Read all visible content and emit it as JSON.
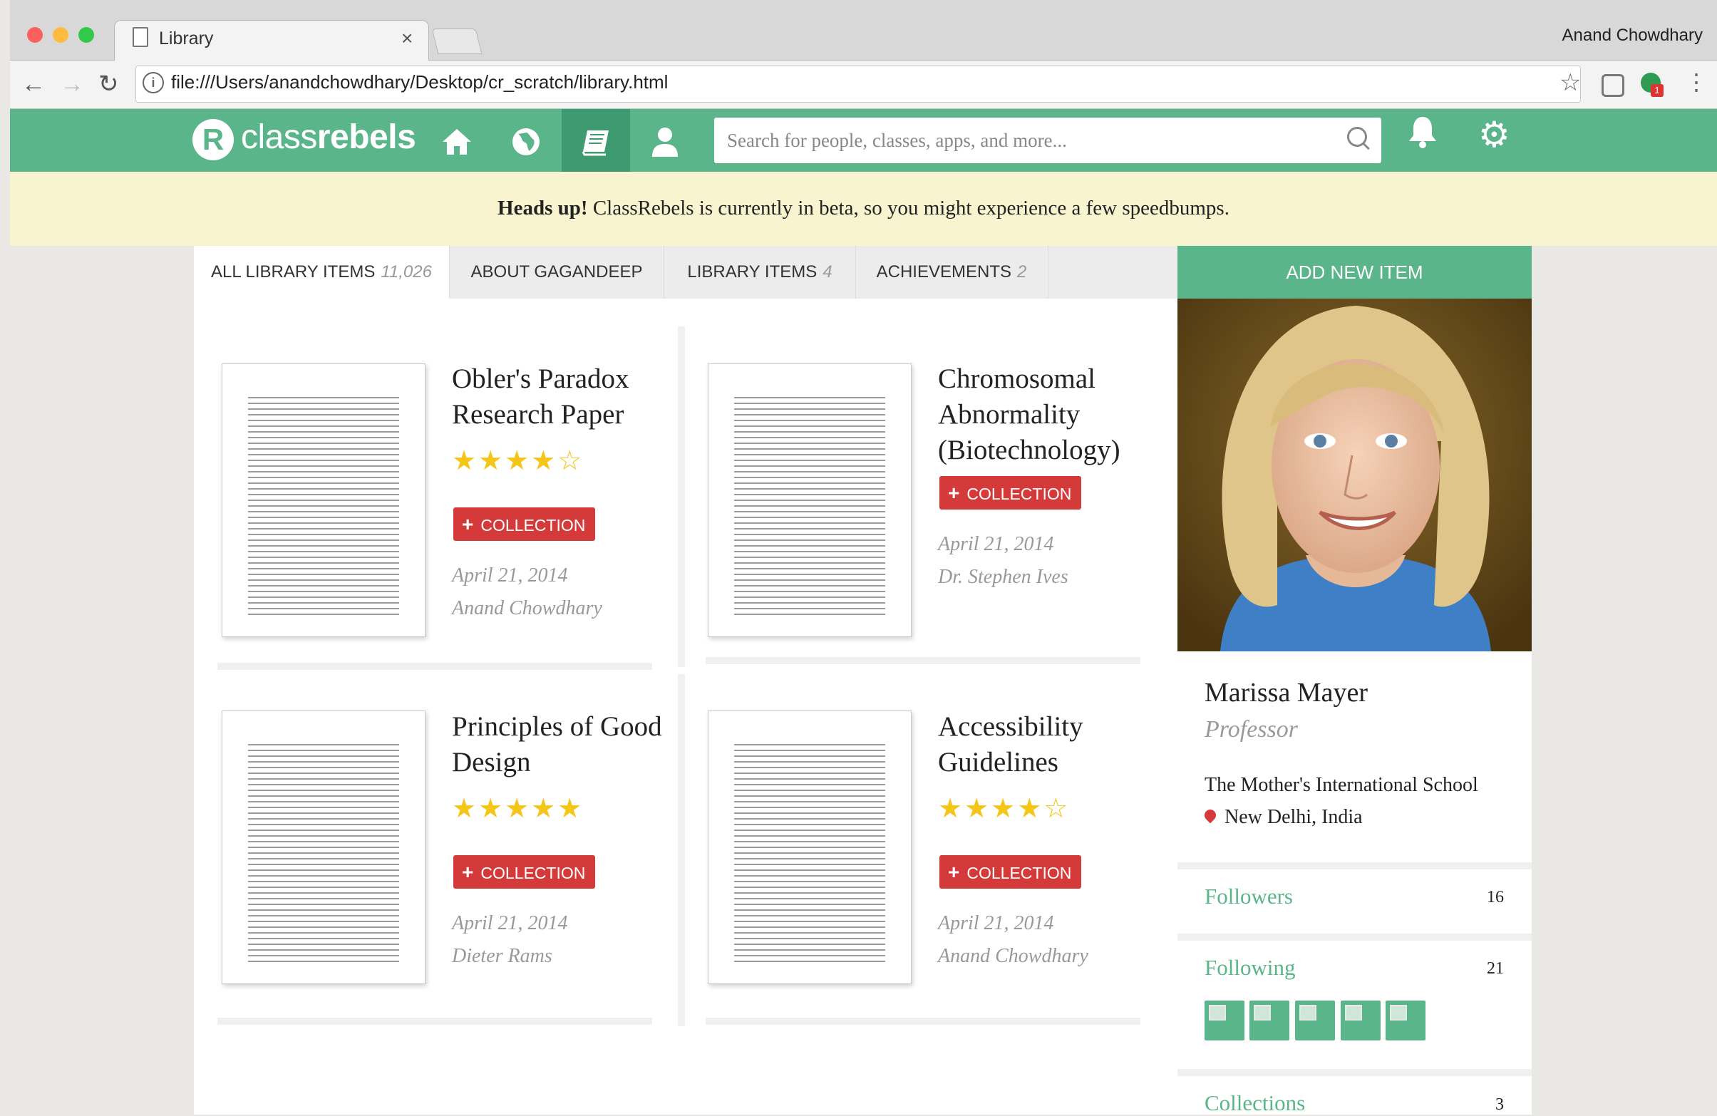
{
  "browser": {
    "tab_title": "Library",
    "tab_close": "×",
    "user_name": "Anand Chowdhary",
    "url": "file:///Users/anandchowdhary/Desktop/cr_scratch/library.html",
    "back": "←",
    "forward": "→",
    "reload": "↻",
    "info": "i",
    "bookmark": "☆",
    "menu": "⋮",
    "extension_badge": "1"
  },
  "app": {
    "logo_letter": "R",
    "logo_light": "class",
    "logo_bold": "rebels",
    "search_placeholder": "Search for people, classes, apps, and more...",
    "nav_icons": {
      "home": "home-icon",
      "globe": "globe-icon",
      "library": "book-icon",
      "profile": "user-icon"
    },
    "bell": "🔔",
    "gear": "⚙"
  },
  "banner": {
    "bold": "Heads up!",
    "text": "ClassRebels is currently in beta, so you might experience a few speedbumps."
  },
  "tabs": [
    {
      "label": "ALL LIBRARY ITEMS",
      "count": "11,026"
    },
    {
      "label": "ABOUT GAGANDEEP",
      "count": ""
    },
    {
      "label": "LIBRARY ITEMS",
      "count": "4"
    },
    {
      "label": "ACHIEVEMENTS",
      "count": "2"
    }
  ],
  "items": [
    {
      "title": "Obler's Paradox Research Paper",
      "rating": 4,
      "stars": "★★★★☆",
      "button": "COLLECTION",
      "date": "April 21, 2014",
      "author": "Anand Chowdhary"
    },
    {
      "title": "Chromosomal Abnormality (Biotechnology)",
      "rating": null,
      "stars": "",
      "button": "COLLECTION",
      "date": "April 21, 2014",
      "author": "Dr. Stephen Ives"
    },
    {
      "title": "Principles of Good Design",
      "rating": 5,
      "stars": "★★★★★",
      "button": "COLLECTION",
      "date": "April 21, 2014",
      "author": "Dieter Rams"
    },
    {
      "title": "Accessibility Guidelines",
      "rating": 4,
      "stars": "★★★★☆",
      "button": "COLLECTION",
      "date": "April 21, 2014",
      "author": "Anand Chowdhary"
    }
  ],
  "sidebar": {
    "add_button": "ADD NEW ITEM",
    "name": "Marissa Mayer",
    "role": "Professor",
    "school": "The Mother's International School",
    "location": "New Delhi, India",
    "followers_label": "Followers",
    "followers_count": "16",
    "following_label": "Following",
    "following_count": "21",
    "following_thumbnails": 5,
    "collections_label": "Collections",
    "collections_count": "3"
  },
  "colors": {
    "brand_green": "#5ab58a",
    "brand_green_dark": "#3e9a70",
    "collection_red": "#d43a3a",
    "star_yellow": "#f5c518",
    "banner_yellow": "#f8f4cf"
  }
}
